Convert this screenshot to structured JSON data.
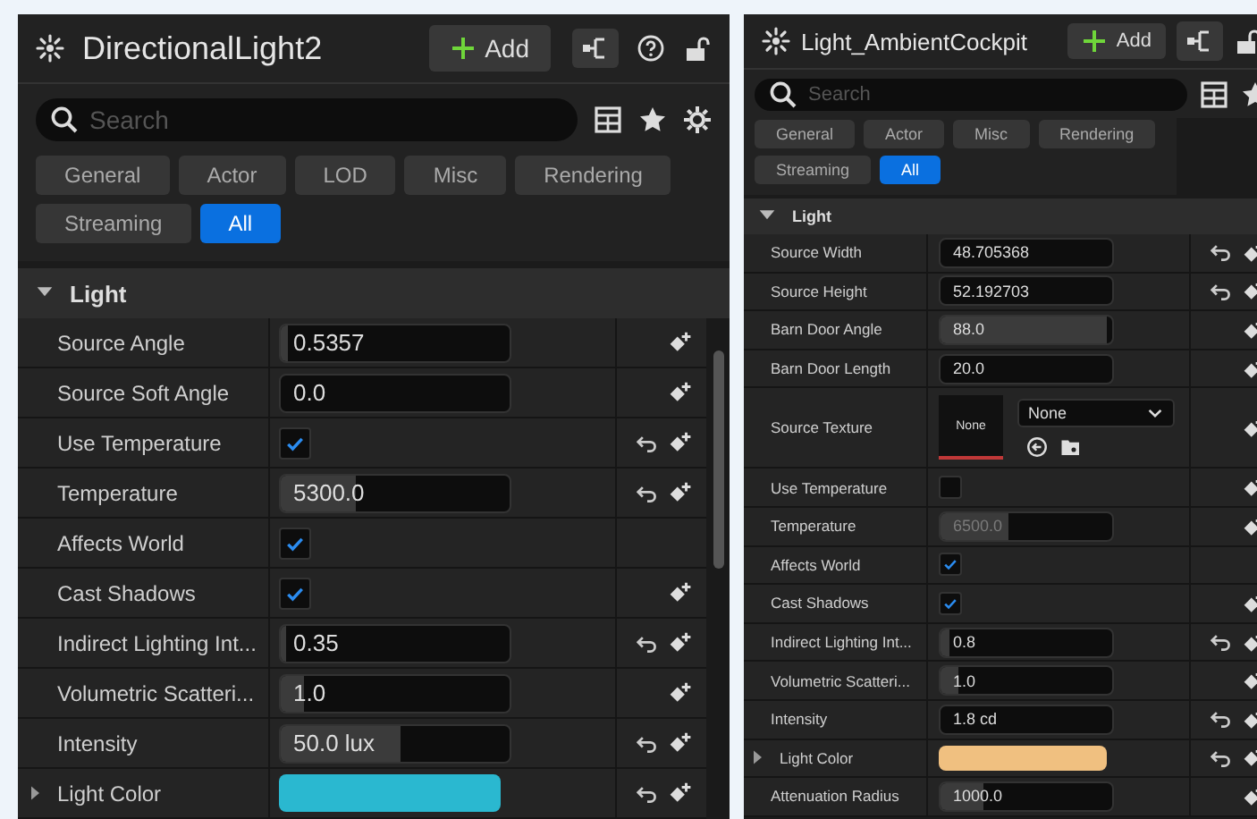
{
  "panels": [
    {
      "title": "DirectionalLight2",
      "add_label": "Add",
      "header_buttons": [
        {
          "kind": "hierarchy"
        },
        {
          "kind": "help"
        },
        {
          "kind": "lock"
        }
      ],
      "search": {
        "placeholder": "Search"
      },
      "tools": [
        {
          "kind": "table"
        },
        {
          "kind": "star"
        },
        {
          "kind": "gear"
        }
      ],
      "filters": [
        {
          "label": "General",
          "selected": false
        },
        {
          "label": "Actor",
          "selected": false
        },
        {
          "label": "LOD",
          "selected": false
        },
        {
          "label": "Misc",
          "selected": false
        },
        {
          "label": "Rendering",
          "selected": false
        },
        {
          "label": "Streaming",
          "selected": false
        },
        {
          "label": "All",
          "selected": true
        }
      ],
      "section": {
        "label": "Light",
        "expanded": true
      },
      "properties": [
        {
          "kind": "number",
          "label": "Source Angle",
          "value": "0.5357",
          "level": 0.03,
          "reset": false,
          "keyframe": true
        },
        {
          "kind": "number",
          "label": "Source Soft Angle",
          "value": "0.0",
          "reset": false,
          "keyframe": true
        },
        {
          "kind": "check",
          "label": "Use Temperature",
          "checked": true,
          "reset": true,
          "keyframe": true
        },
        {
          "kind": "number",
          "label": "Temperature",
          "value": "5300.0",
          "level": 0.33,
          "reset": true,
          "keyframe": true
        },
        {
          "kind": "check",
          "label": "Affects World",
          "checked": true,
          "reset": false,
          "keyframe": false
        },
        {
          "kind": "check",
          "label": "Cast Shadows",
          "checked": true,
          "reset": false,
          "keyframe": true
        },
        {
          "kind": "number",
          "label": "Indirect Lighting Int...",
          "value": "0.35",
          "level": 0.02,
          "reset": true,
          "keyframe": true
        },
        {
          "kind": "number",
          "label": "Volumetric Scatteri...",
          "value": "1.0",
          "level": 0.1,
          "reset": false,
          "keyframe": true
        },
        {
          "kind": "number",
          "label": "Intensity",
          "value": "50.0 lux",
          "level": 0.52,
          "reset": true,
          "keyframe": true
        },
        {
          "kind": "color",
          "label": "Light Color",
          "color": "#2ab8d0",
          "expanded": false,
          "reset": true,
          "keyframe": true
        }
      ]
    },
    {
      "title": "Light_AmbientCockpit",
      "add_label": "Add",
      "header_buttons": [
        {
          "kind": "hierarchy"
        },
        {
          "kind": "lock"
        }
      ],
      "search": {
        "placeholder": "Search"
      },
      "tools": [
        {
          "kind": "table"
        },
        {
          "kind": "star"
        }
      ],
      "filters": [
        {
          "label": "General",
          "selected": false
        },
        {
          "label": "Actor",
          "selected": false
        },
        {
          "label": "Misc",
          "selected": false
        },
        {
          "label": "Rendering",
          "selected": false
        },
        {
          "label": "Streaming",
          "selected": false
        },
        {
          "label": "All",
          "selected": true
        }
      ],
      "section": {
        "label": "Light",
        "expanded": true
      },
      "properties": [
        {
          "kind": "number",
          "label": "Source Width",
          "value": "48.705368",
          "reset": true,
          "keyframe": true
        },
        {
          "kind": "number",
          "label": "Source Height",
          "value": "52.192703",
          "reset": true,
          "keyframe": true
        },
        {
          "kind": "number",
          "label": "Barn Door Angle",
          "value": "88.0",
          "level": 0.97,
          "reset": false,
          "keyframe": true
        },
        {
          "kind": "number",
          "label": "Barn Door Length",
          "value": "20.0",
          "reset": false,
          "keyframe": true
        },
        {
          "kind": "texture",
          "label": "Source Texture",
          "thumb_label": "None",
          "asset": "None",
          "reset": false,
          "keyframe": true
        },
        {
          "kind": "check",
          "label": "Use Temperature",
          "checked": false,
          "reset": false,
          "keyframe": true
        },
        {
          "kind": "number",
          "label": "Temperature",
          "value": "6500.0",
          "level": 0.4,
          "disabled": true,
          "reset": false,
          "keyframe": true
        },
        {
          "kind": "check",
          "label": "Affects World",
          "checked": true,
          "reset": false,
          "keyframe": false
        },
        {
          "kind": "check",
          "label": "Cast Shadows",
          "checked": true,
          "reset": false,
          "keyframe": true
        },
        {
          "kind": "number",
          "label": "Indirect Lighting Int...",
          "value": "0.8",
          "level": 0.05,
          "reset": true,
          "keyframe": true
        },
        {
          "kind": "number",
          "label": "Volumetric Scatteri...",
          "value": "1.0",
          "level": 0.1,
          "reset": false,
          "keyframe": true
        },
        {
          "kind": "number",
          "label": "Intensity",
          "value": "1.8 cd",
          "reset": true,
          "keyframe": true
        },
        {
          "kind": "color",
          "label": "Light Color",
          "color": "#f0c080",
          "expanded": false,
          "reset": true,
          "keyframe": true
        },
        {
          "kind": "number",
          "label": "Attenuation Radius",
          "value": "1000.0",
          "level": 0.25,
          "reset": false,
          "keyframe": true
        }
      ]
    }
  ]
}
